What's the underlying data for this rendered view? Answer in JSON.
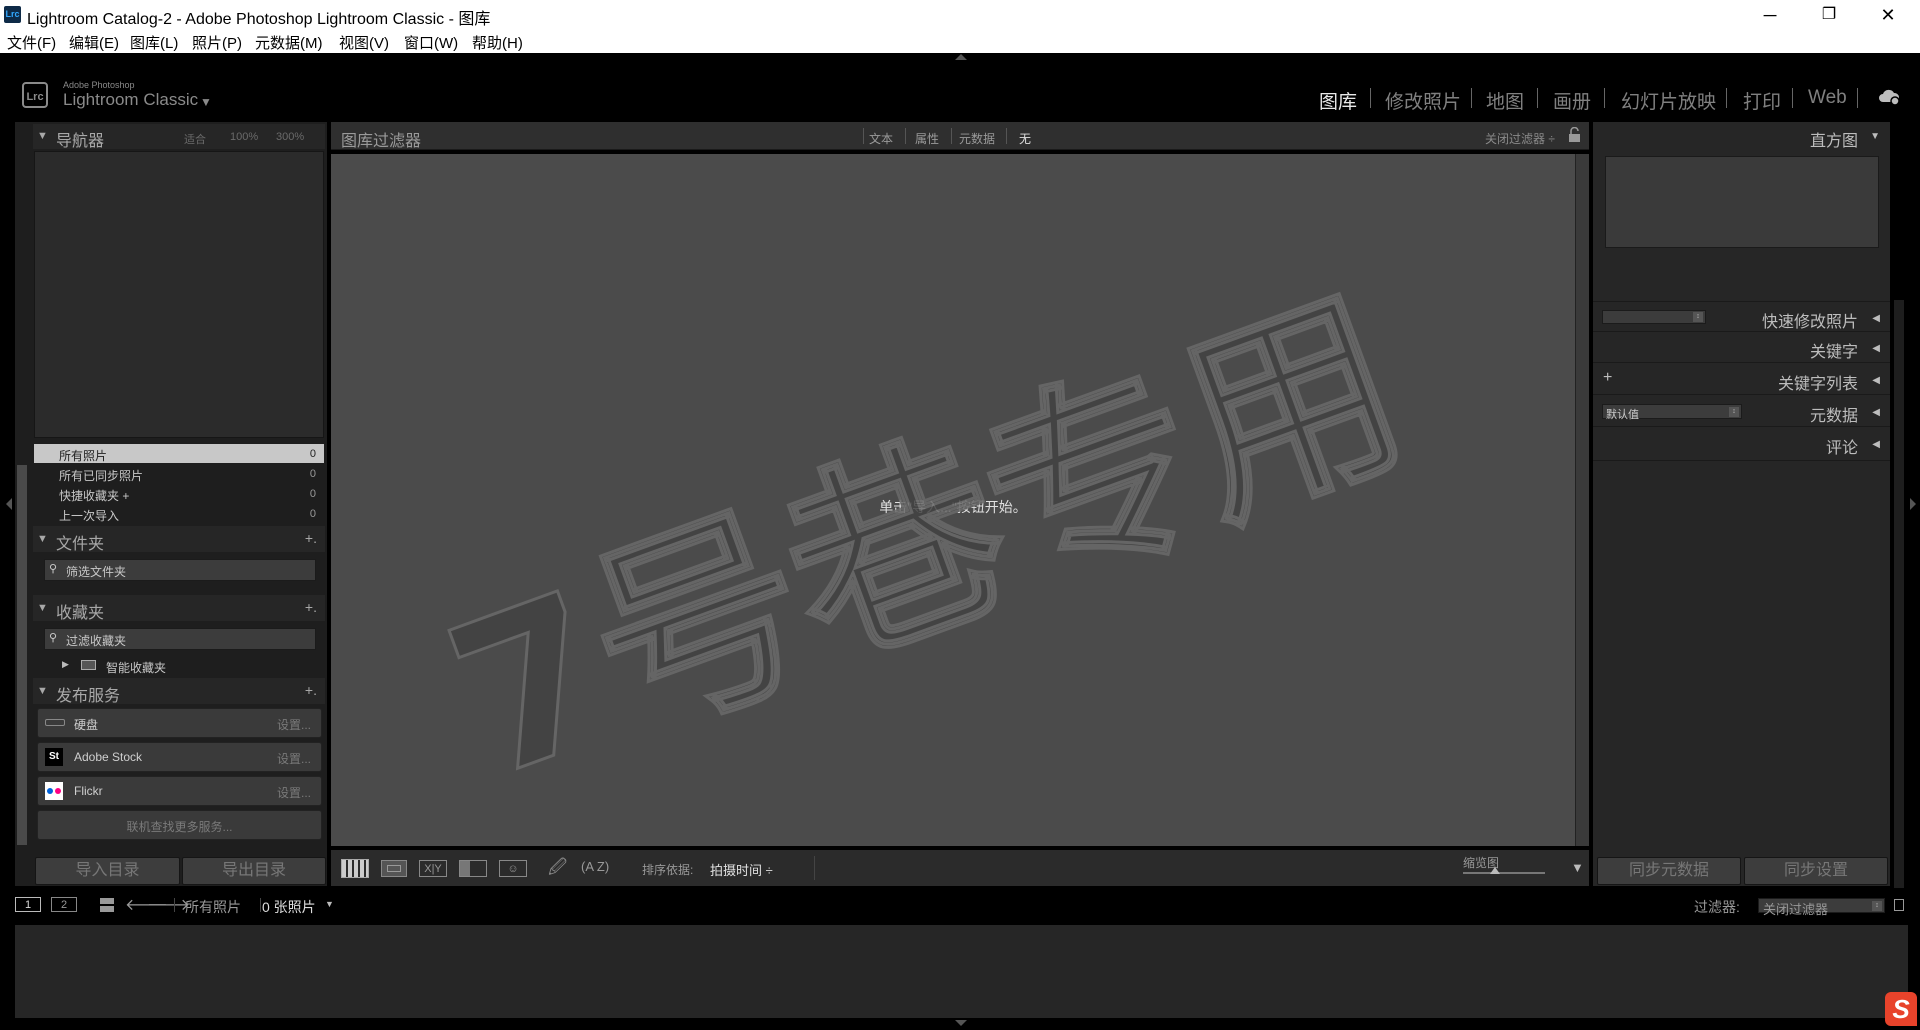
{
  "window": {
    "title": "Lightroom Catalog-2 - Adobe Photoshop Lightroom Classic - 图库",
    "app_icon": "Lrc",
    "minimize": "─",
    "maximize": "❐",
    "close": "✕"
  },
  "menu": [
    "文件(F)",
    "编辑(E)",
    "图库(L)",
    "照片(P)",
    "元数据(M)",
    "视图(V)",
    "窗口(W)",
    "帮助(H)"
  ],
  "identity": {
    "badge": "Lrc",
    "vendor": "Adobe Photoshop",
    "product": "Lightroom Classic",
    "caret": "▼"
  },
  "modules": [
    "图库",
    "修改照片",
    "地图",
    "画册",
    "幻灯片放映",
    "打印",
    "Web"
  ],
  "active_module": "图库",
  "navigator": {
    "title": "导航器",
    "zoom": [
      "适合",
      "100%",
      "300%"
    ]
  },
  "catalog": [
    {
      "label": "所有照片",
      "count": "0"
    },
    {
      "label": "所有已同步照片",
      "count": "0"
    },
    {
      "label": "快捷收藏夹 +",
      "count": "0"
    },
    {
      "label": "上一次导入",
      "count": "0"
    }
  ],
  "folders": {
    "title": "文件夹",
    "add": "+.",
    "search": "筛选文件夹"
  },
  "collections": {
    "title": "收藏夹",
    "add": "+.",
    "search": "过滤收藏夹",
    "smart": "智能收藏夹"
  },
  "publish": {
    "title": "发布服务",
    "add": "+.",
    "services": [
      {
        "label": "硬盘",
        "setup": "设置..."
      },
      {
        "label": "Adobe Stock",
        "setup": "设置...",
        "badge": "St"
      },
      {
        "label": "Flickr",
        "setup": "设置..."
      }
    ],
    "find_more": "联机查找更多服务..."
  },
  "import_button": "导入目录",
  "export_button": "导出目录",
  "filter_bar": {
    "title": "图库过滤器",
    "options": [
      "文本",
      "属性",
      "元数据",
      "无"
    ],
    "active": "无",
    "close_filter": "关闭过滤器 ÷"
  },
  "center_message": "单击\"导入...\"按钮开始。",
  "watermark": "7号巷专用",
  "toolbar": {
    "sort_label": "排序依据:",
    "sort_value": "拍摄时间 ÷",
    "thumb_label": "缩览图",
    "az": "A Z",
    "menu_caret": "▼"
  },
  "right_panel": {
    "histogram": "直方图",
    "quick_develop": "快速修改照片",
    "keywording": "关键字",
    "keyword_list": "关键字列表",
    "metadata": "元数据",
    "metadata_preset": "默认值",
    "comments": "评论",
    "add": "+",
    "sync_metadata": "同步元数据",
    "sync_settings": "同步设置"
  },
  "filmstrip": {
    "screen1": "1",
    "screen2": "2",
    "source": "所有照片",
    "count": "0 张照片",
    "caret": "▼",
    "filter_label": "过滤器:",
    "filter_value": "关闭过滤器"
  },
  "tray": {
    "ime_badge": "S"
  }
}
